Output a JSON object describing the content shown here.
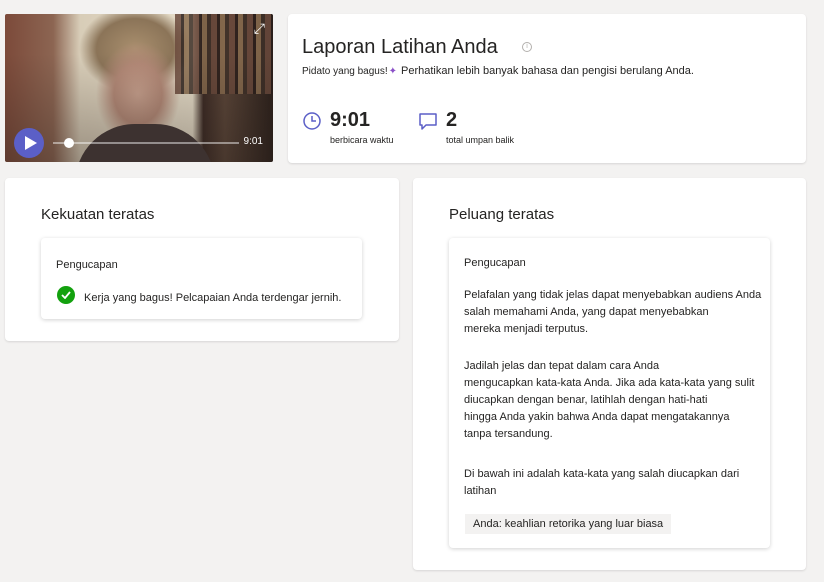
{
  "video": {
    "duration": "9:01",
    "expand_icon": "expand-icon",
    "play_icon": "play-icon",
    "progress": 0.06
  },
  "report": {
    "title": "Laporan Latihan Anda",
    "good_speech": "Pidato yang bagus!",
    "summary": "Perhatikan lebih banyak bahasa dan pengisi berulang Anda.",
    "time_value": "9:01",
    "time_label": "berbicara waktu",
    "feedback_value": "2",
    "feedback_label": "total umpan balik",
    "accent": "#5b5fc7"
  },
  "strengths": {
    "title": "Kekuatan teratas",
    "category": "Pengucapan",
    "text": "Kerja yang bagus! Pelcapaian Anda terdengar jernih."
  },
  "opportunities": {
    "title": "Peluang teratas",
    "category": "Pengucapan",
    "paragraph1_line1": "Pelafalan yang tidak jelas dapat menyebabkan audiens Anda",
    "paragraph1_line2": "salah memahami Anda, yang dapat menyebabkan",
    "paragraph1_line3": "mereka menjadi terputus.",
    "paragraph2_line1": "Jadilah jelas dan tepat dalam cara Anda",
    "paragraph2_line2": "mengucapkan kata-kata Anda. Jika ada kata-kata yang sulit",
    "paragraph2_line3": "diucapkan dengan benar, latihlah dengan hati-hati",
    "paragraph2_line4": "hingga Anda yakin bahwa Anda dapat mengatakannya",
    "paragraph2_line5": "tanpa tersandung.",
    "paragraph3_line1": "Di bawah ini adalah kata-kata yang salah diucapkan dari",
    "paragraph3_line2": "latihan",
    "word": "Anda: keahlian retorika yang luar biasa"
  }
}
